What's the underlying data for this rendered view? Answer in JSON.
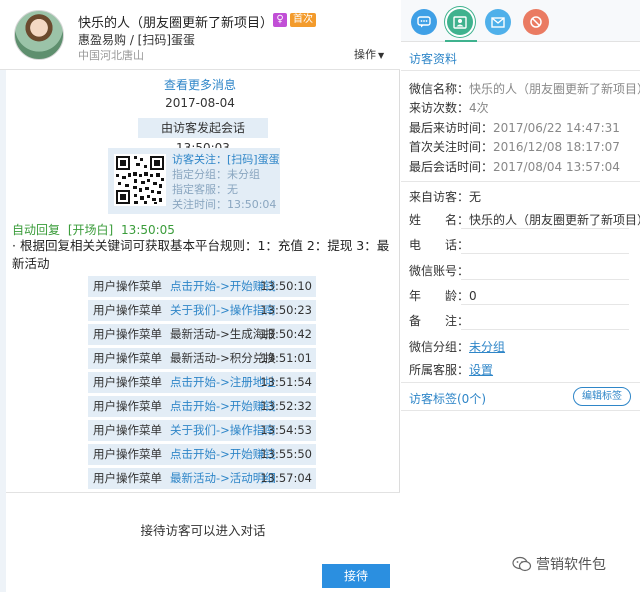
{
  "header": {
    "name": "快乐的人（朋友圈更新了新项目）",
    "gender_badge": "♀",
    "first_visit_badge": "首次",
    "line2": "惠盈易购 / [扫码]蛋蛋",
    "location": "中国河北唐山",
    "ops_label": "操作"
  },
  "chat": {
    "more_messages": "查看更多消息",
    "date": "2017-08-04",
    "session_start": "由访客发起会话 13:50:03",
    "card": {
      "line1": "访客关注：[扫码]蛋蛋",
      "line2": "指定分组：未分组",
      "line3": "指定客服：无",
      "line4": "关注时间：13:50:04"
    },
    "auto_reply_label": "自动回复",
    "auto_reply_tag": "[开场白]",
    "auto_reply_time": "13:50:05",
    "auto_reply_body": "· 根据回复相关关键词可获取基本平台规则：1：充值 2：提现 3：最新活动",
    "ops": [
      {
        "label": "用户操作菜单",
        "action": "点击开始->开始赚钱",
        "time": "13:50:10",
        "color": "blue"
      },
      {
        "label": "用户操作菜单",
        "action": "关于我们->操作指南",
        "time": "13:50:23",
        "color": "blue"
      },
      {
        "label": "用户操作菜单",
        "action": "最新活动->生成海报",
        "time": "13:50:42",
        "color": "dark"
      },
      {
        "label": "用户操作菜单",
        "action": "最新活动->积分兑换",
        "time": "13:51:01",
        "color": "dark"
      },
      {
        "label": "用户操作菜单",
        "action": "点击开始->注册地址",
        "time": "13:51:54",
        "color": "blue"
      },
      {
        "label": "用户操作菜单",
        "action": "点击开始->开始赚钱",
        "time": "13:52:32",
        "color": "blue"
      },
      {
        "label": "用户操作菜单",
        "action": "关于我们->操作指南",
        "time": "13:54:53",
        "color": "blue"
      },
      {
        "label": "用户操作菜单",
        "action": "点击开始->开始赚钱",
        "time": "13:55:50",
        "color": "blue"
      },
      {
        "label": "用户操作菜单",
        "action": "最新活动->活动明细",
        "time": "13:57:04",
        "color": "blue"
      }
    ],
    "accept_hint": "接待访客可以进入对话",
    "accept_button": "接待"
  },
  "sidebar": {
    "tab_icons": [
      "chat-bubble-icon",
      "contact-card-icon",
      "mail-icon",
      "no-entry-icon"
    ],
    "section_title": "访客资料",
    "wechat_name_label": "微信名称：",
    "wechat_name_value": "快乐的人（朋友圈更新了新项目）",
    "visit_count_label": "来访次数：",
    "visit_count_value": "4次",
    "last_visit_label": "最后来访时间：",
    "last_visit_value": "2017/06/22 14:47:31",
    "first_follow_label": "首次关注时间：",
    "first_follow_value": "2016/12/08 18:17:07",
    "last_session_label": "最后会话时间：",
    "last_session_value": "2017/08/04 13:57:04",
    "source_label": "来自访客：",
    "source_value": "无",
    "full_name_label": "姓　　名：",
    "full_name_value": "快乐的人（朋友圈更新了新项目）",
    "phone_label": "电　　话：",
    "wechat_account_label": "微信账号：",
    "age_label": "年　　龄：",
    "age_value": "0",
    "notes_label": "备　　注：",
    "group_label": "微信分组：",
    "group_value": "未分组",
    "agent_label": "所属客服：",
    "agent_value": "设置",
    "tags_title": "访客标签(0个)",
    "edit_tags": "编辑标签"
  },
  "watermark": "营销软件包",
  "colors": {
    "accent": "#2b8fe0",
    "bubble": "#e3edf6",
    "green": "#3a9c3a",
    "badge_first": "#f39b2c"
  }
}
